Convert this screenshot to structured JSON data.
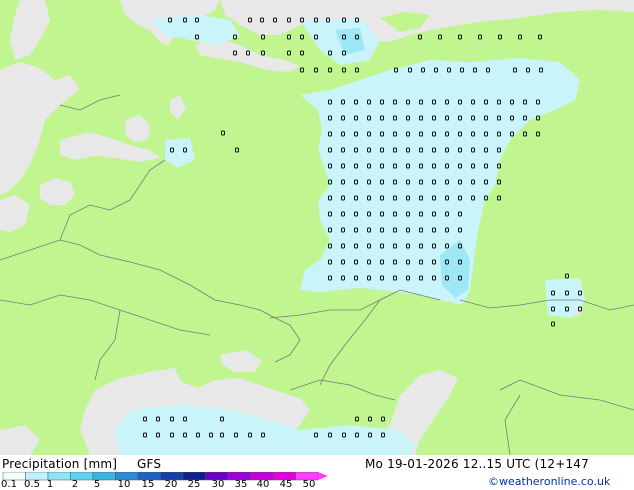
{
  "title": "Precipitation [mm]",
  "model": "GFS",
  "valid_time": "Mo 19-01-2026 12..15 UTC (12+147",
  "credit": "©weatheronline.co.uk",
  "legend_ticks": [
    "0.1",
    "0.5",
    "1",
    "2",
    "5",
    "10",
    "15",
    "20",
    "25",
    "30",
    "35",
    "40",
    "45",
    "50"
  ],
  "legend_colors": [
    "#f0fbff",
    "#bff2fb",
    "#8ee4f6",
    "#5fd2f0",
    "#3db3e4",
    "#2b8ad4",
    "#1c63c4",
    "#1640a8",
    "#0f1f8a",
    "#6a00c8",
    "#9a00d8",
    "#c400d8",
    "#e000e0",
    "#ff3cff"
  ],
  "colors": {
    "land": "#c0f58f",
    "sea": "#e8e8e8",
    "precip_light": "#c8f4fa",
    "precip_mid": "#9de8f4",
    "border": "#7a7a7a"
  }
}
